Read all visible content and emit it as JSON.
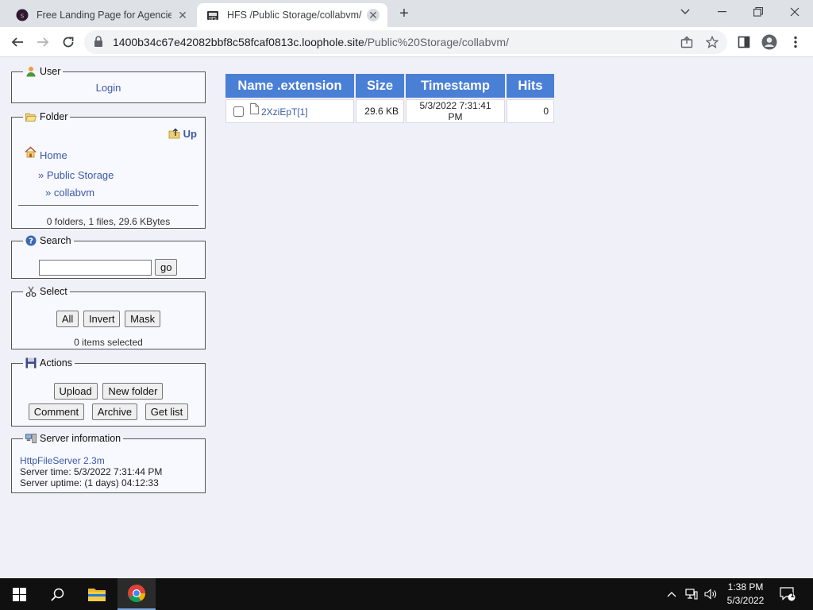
{
  "browser": {
    "tabs": [
      {
        "title": "Free Landing Page for Agencies -",
        "active": false
      },
      {
        "title": "HFS /Public Storage/collabvm/",
        "active": true
      }
    ],
    "url_host": "1400b34c67e42082bbf8c58fcaf0813c.loophole.site",
    "url_path": "/Public%20Storage/collabvm/"
  },
  "sidebar": {
    "user": {
      "legend": "User",
      "login": "Login"
    },
    "folder": {
      "legend": "Folder",
      "up": "Up",
      "home": "Home",
      "crumb1": "» Public Storage",
      "crumb2": "» collabvm",
      "summary": "0 folders, 1 files, 29.6 KBytes"
    },
    "search": {
      "legend": "Search",
      "value": "",
      "go": "go"
    },
    "select": {
      "legend": "Select",
      "all": "All",
      "invert": "Invert",
      "mask": "Mask",
      "count": "0 items selected"
    },
    "actions": {
      "legend": "Actions",
      "upload": "Upload",
      "new_folder": "New folder",
      "comment": "Comment",
      "archive": "Archive",
      "get_list": "Get list"
    },
    "server": {
      "legend": "Server information",
      "software": "HttpFileServer 2.3m",
      "time": "Server time: 5/3/2022 7:31:44 PM",
      "uptime": "Server uptime: (1 days) 04:12:33"
    }
  },
  "files": {
    "headers": {
      "name": "Name .extension",
      "size": "Size",
      "timestamp": "Timestamp",
      "hits": "Hits"
    },
    "rows": [
      {
        "name": "2XziEpT[1]",
        "size": "29.6 KB",
        "timestamp": "5/3/2022 7:31:41 PM",
        "hits": "0",
        "checked": false
      }
    ]
  },
  "taskbar": {
    "time": "1:38 PM",
    "date": "5/3/2022",
    "notifications": "1"
  },
  "colors": {
    "table_header": "#4a7fd6",
    "link": "#3b5aa8",
    "page_bg": "#f0f0f8"
  }
}
